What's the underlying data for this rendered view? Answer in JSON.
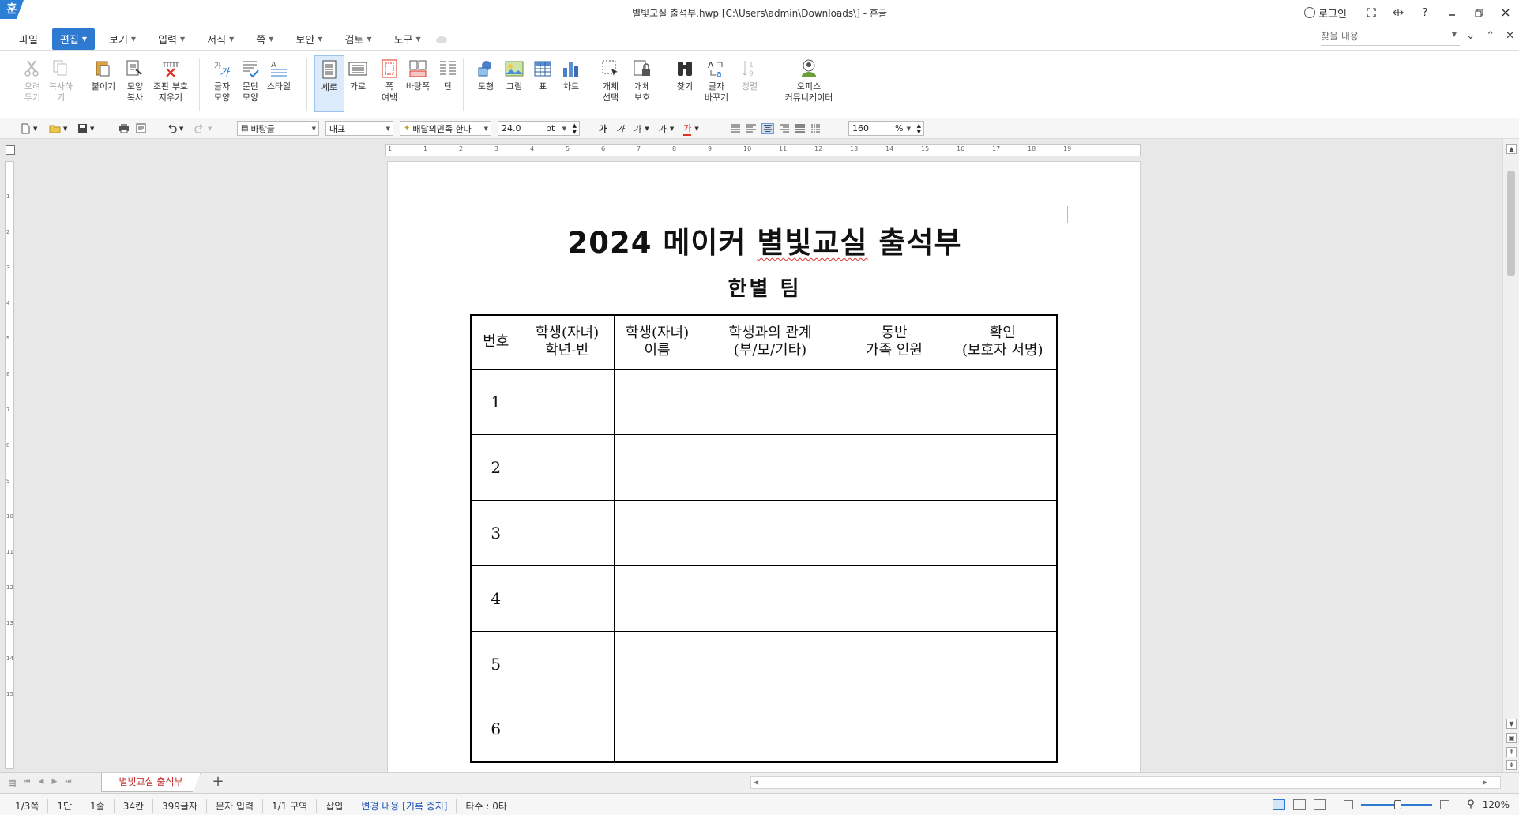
{
  "window": {
    "app_icon": "훈",
    "title": "별빛교실 출석부.hwp [C:\\Users\\admin\\Downloads\\] - 훈글",
    "login": "로그인",
    "buttons": [
      "fullscreen-icon",
      "expand-width-icon",
      "help-icon",
      "minimize-icon",
      "restore-icon",
      "close-icon"
    ],
    "help_glyph": "?"
  },
  "menu": {
    "items": [
      {
        "label": "파일",
        "caret": false
      },
      {
        "label": "편집",
        "caret": true,
        "active": true
      },
      {
        "label": "보기",
        "caret": true
      },
      {
        "label": "입력",
        "caret": true
      },
      {
        "label": "서식",
        "caret": true
      },
      {
        "label": "쪽",
        "caret": true
      },
      {
        "label": "보안",
        "caret": true
      },
      {
        "label": "검토",
        "caret": true
      },
      {
        "label": "도구",
        "caret": true
      }
    ],
    "search_placeholder": "찾을 내용"
  },
  "ribbon": {
    "buttons": [
      {
        "label": "오려\n두기",
        "icon": "scissors-icon",
        "disabled": true
      },
      {
        "label": "복사하기",
        "icon": "copy-icon",
        "disabled": true
      },
      {
        "label": "붙이기",
        "icon": "paste-icon"
      },
      {
        "label": "모양\n복사",
        "icon": "format-copy-icon"
      },
      {
        "label": "조판 부호\n지우기",
        "icon": "clear-codes-icon"
      },
      {
        "label": "글자\n모양",
        "icon": "char-shape-icon"
      },
      {
        "label": "문단\n모양",
        "icon": "para-shape-icon"
      },
      {
        "label": "스타일",
        "icon": "style-icon"
      },
      {
        "label": "세로",
        "icon": "portrait-icon",
        "selected": true
      },
      {
        "label": "가로",
        "icon": "landscape-icon"
      },
      {
        "label": "쪽\n여백",
        "icon": "page-margin-icon"
      },
      {
        "label": "바탕쪽",
        "icon": "master-page-icon"
      },
      {
        "label": "단",
        "icon": "columns-icon"
      },
      {
        "label": "도형",
        "icon": "shape-icon"
      },
      {
        "label": "그림",
        "icon": "picture-icon"
      },
      {
        "label": "표",
        "icon": "table-icon"
      },
      {
        "label": "차트",
        "icon": "chart-icon"
      },
      {
        "label": "개체\n선택",
        "icon": "object-select-icon"
      },
      {
        "label": "개체\n보호",
        "icon": "object-protect-icon"
      },
      {
        "label": "찾기",
        "icon": "binoculars-icon"
      },
      {
        "label": "글자\n바꾸기",
        "icon": "replace-icon"
      },
      {
        "label": "정렬",
        "icon": "sort-icon",
        "disabled": true
      },
      {
        "label": "오피스\n커뮤니케이터",
        "icon": "communicator-icon"
      }
    ]
  },
  "toolbar2": {
    "style_name": "바탕글",
    "language": "대표",
    "font_name": "배달의민족 한나",
    "font_size": "24.0",
    "font_unit": "pt",
    "char_buttons": [
      "가",
      "가",
      "가",
      "가",
      "가"
    ],
    "zoom_value": "160",
    "zoom_unit": "%"
  },
  "ruler": {
    "h_ticks": [
      "1",
      "1",
      "2",
      "3",
      "4",
      "5",
      "6",
      "7",
      "8",
      "9",
      "10",
      "11",
      "12",
      "13",
      "14",
      "15",
      "16",
      "17",
      "18",
      "19"
    ],
    "v_ticks": [
      "1",
      "2",
      "3",
      "4",
      "5",
      "6",
      "7",
      "8",
      "9",
      "10",
      "11",
      "12",
      "13",
      "14",
      "15"
    ]
  },
  "document": {
    "title_prefix": "2024 메이커 ",
    "title_misspelled": "별빛교실",
    "title_suffix": " 출석부",
    "subtitle": "한별 팀",
    "table": {
      "headers": [
        [
          "번호"
        ],
        [
          "학생(자녀)",
          "학년-반"
        ],
        [
          "학생(자녀)",
          "이름"
        ],
        [
          "학생과의 관계",
          "(부/모/기타)"
        ],
        [
          "동반",
          "가족 인원"
        ],
        [
          "확인",
          "(보호자 서명)"
        ]
      ],
      "rows": [
        "1",
        "2",
        "3",
        "4",
        "5",
        "6"
      ]
    }
  },
  "tabs": {
    "sheet_name": "별빛교실 출석부",
    "add_glyph": "+"
  },
  "status": {
    "items": [
      "1/3쪽",
      "1단",
      "1줄",
      "34칸",
      "399글자",
      "문자 입력",
      "1/1 구역",
      "삽입",
      "변경 내용 [기록 중지]",
      "타수 : 0타"
    ],
    "zoom": "120%"
  },
  "colors": {
    "accent": "#2e7ad1",
    "tab_text": "#c62828",
    "status_highlight": "#1a4fb5"
  }
}
